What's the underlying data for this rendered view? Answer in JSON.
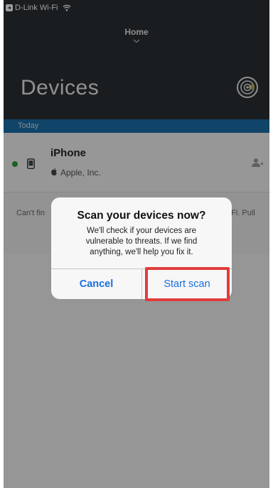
{
  "status_bar": {
    "carrier": "D-Link Wi-Fi"
  },
  "nav": {
    "title": "Home"
  },
  "page": {
    "title": "Devices"
  },
  "section": {
    "label": "Today"
  },
  "device": {
    "name": "iPhone",
    "manufacturer": "Apple, Inc.",
    "status_color": "#2e9b3a"
  },
  "info": {
    "left_text": "Can't fin",
    "right_text": "i-Fi. Pull"
  },
  "dialog": {
    "title": "Scan your devices now?",
    "message": "We'll check if your devices are vulnerable to threats. If we find anything, we'll help you fix it.",
    "cancel_label": "Cancel",
    "start_label": "Start scan"
  },
  "colors": {
    "header_bg": "#2a2f35",
    "section_bar": "#1b6ea8",
    "accent": "#1a6fe0",
    "highlight": "#e03c3c"
  }
}
